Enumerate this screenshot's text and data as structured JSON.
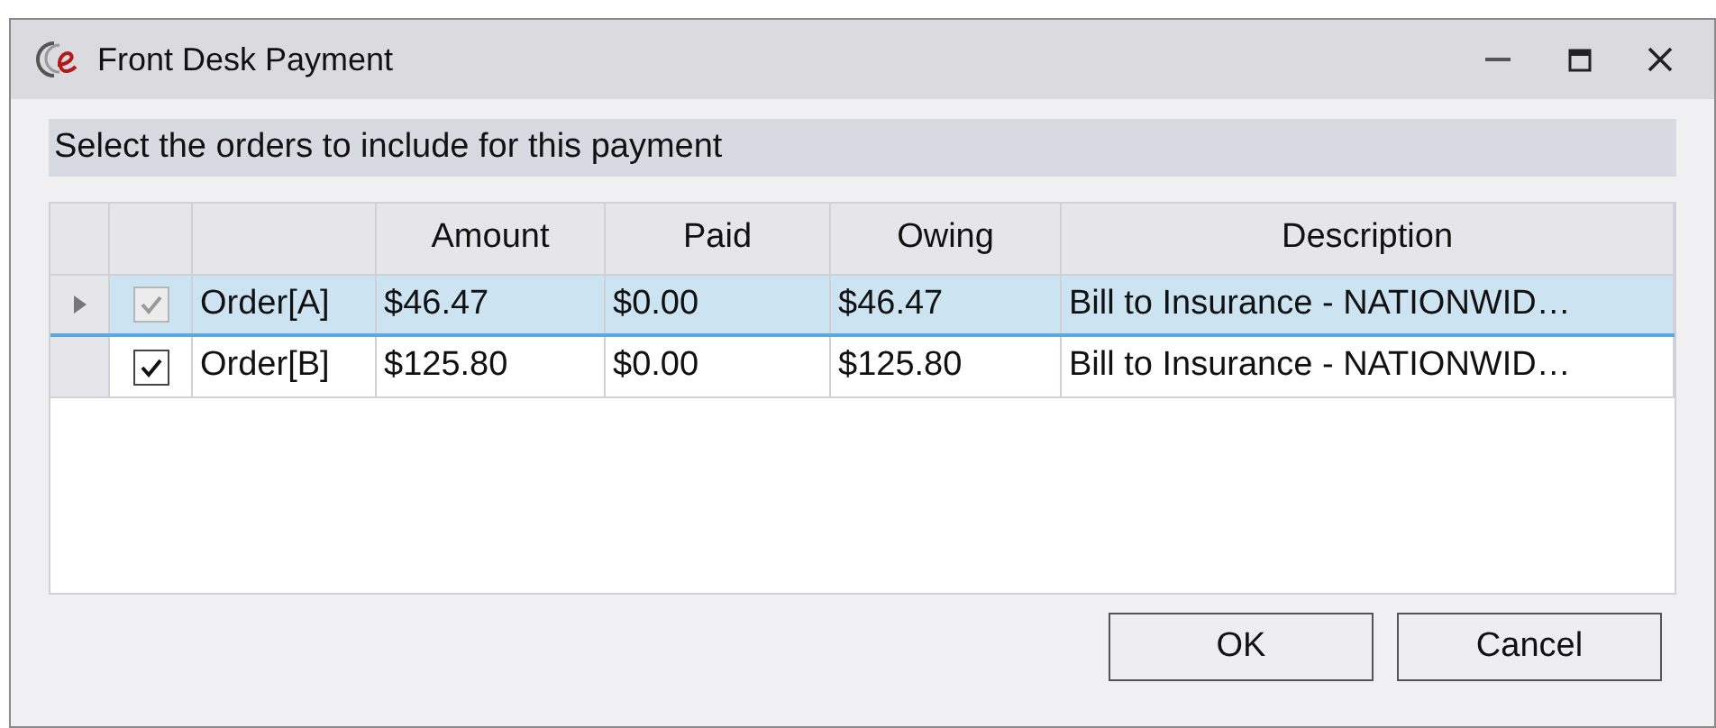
{
  "window": {
    "title": "Front Desk Payment"
  },
  "instruction": "Select the orders to include for this payment",
  "table": {
    "columns": [
      "Amount",
      "Paid",
      "Owing",
      "Description"
    ],
    "rows": [
      {
        "selected": true,
        "checked": true,
        "disabled": true,
        "name": "Order[A]",
        "cells": [
          "$46.47",
          "$0.00",
          "$46.47",
          "Bill to Insurance - NATIONWID…"
        ]
      },
      {
        "selected": false,
        "checked": true,
        "disabled": false,
        "name": "Order[B]",
        "cells": [
          "$125.80",
          "$0.00",
          "$125.80",
          "Bill to Insurance - NATIONWID…"
        ]
      }
    ]
  },
  "buttons": [
    "OK",
    "Cancel"
  ]
}
